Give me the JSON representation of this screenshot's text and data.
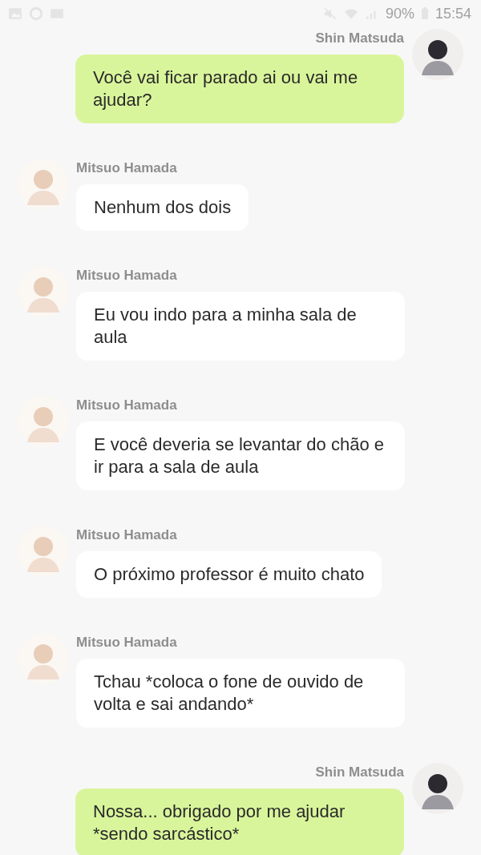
{
  "status_bar": {
    "battery": "90%",
    "time": "15:54"
  },
  "messages": [
    {
      "kind": "sent",
      "sender": "Shin Matsuda",
      "text": "Você vai ficar parado ai ou vai me ajudar?"
    },
    {
      "kind": "received",
      "sender": "Mitsuo Hamada",
      "text": "Nenhum dos dois"
    },
    {
      "kind": "received",
      "sender": "Mitsuo Hamada",
      "text": "Eu vou indo para a minha sala de aula"
    },
    {
      "kind": "received",
      "sender": "Mitsuo Hamada",
      "text": "E você deveria se levantar do chão e ir para a sala de aula"
    },
    {
      "kind": "received",
      "sender": "Mitsuo Hamada",
      "text": "O próximo professor é muito chato"
    },
    {
      "kind": "received",
      "sender": "Mitsuo Hamada",
      "text": "Tchau *coloca o fone de ouvido de volta e sai andando*"
    },
    {
      "kind": "sent",
      "sender": "Shin Matsuda",
      "text": "Nossa... obrigado por me ajudar *sendo sarcástico*"
    }
  ]
}
